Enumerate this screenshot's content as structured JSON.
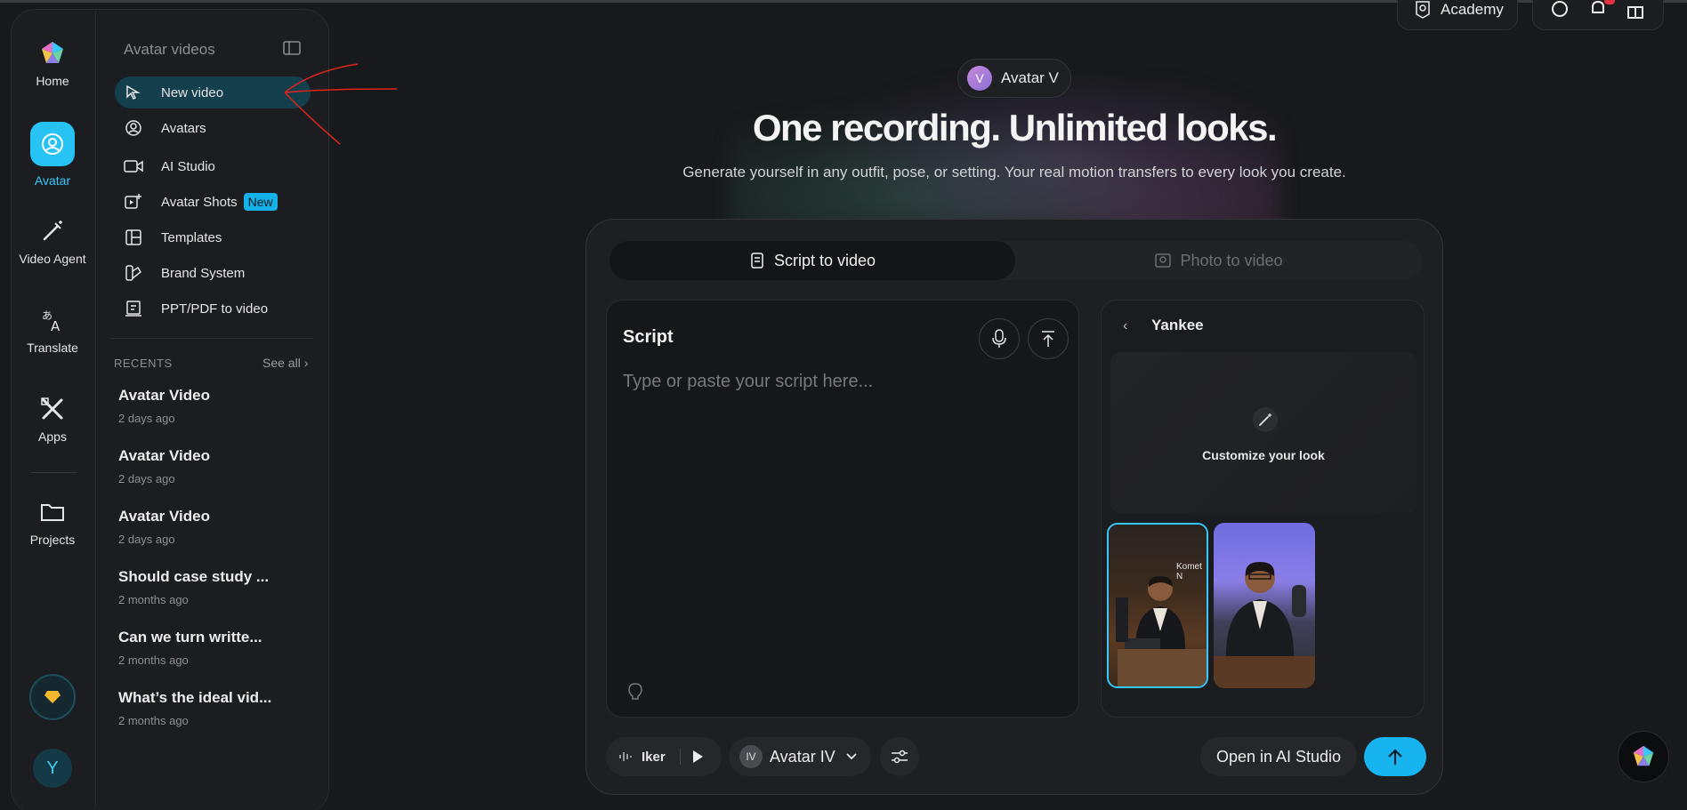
{
  "rail": {
    "home": "Home",
    "avatar": "Avatar",
    "video_agent": "Video Agent",
    "translate": "Translate",
    "apps": "Apps",
    "projects": "Projects",
    "user_initial": "Y"
  },
  "menu": {
    "title": "Avatar videos",
    "items": [
      {
        "label": "New video",
        "icon": "cursor-icon"
      },
      {
        "label": "Avatars",
        "icon": "avatar-circle-icon"
      },
      {
        "label": "AI Studio",
        "icon": "video-camera-icon"
      },
      {
        "label": "Avatar Shots",
        "icon": "image-plus-icon",
        "badge": "New"
      },
      {
        "label": "Templates",
        "icon": "layout-icon"
      },
      {
        "label": "Brand System",
        "icon": "brand-icon"
      },
      {
        "label": "PPT/PDF to video",
        "icon": "slides-icon"
      }
    ],
    "recents_label": "RECENTS",
    "see_all": "See all ›",
    "recents": [
      {
        "title": "Avatar Video",
        "time": "2 days ago"
      },
      {
        "title": "Avatar Video",
        "time": "2 days ago"
      },
      {
        "title": "Avatar Video",
        "time": "2 days ago"
      },
      {
        "title": "Should case study ...",
        "time": "2 months ago"
      },
      {
        "title": "Can we turn writte...",
        "time": "2 months ago"
      },
      {
        "title": "What’s the ideal vid...",
        "time": "2 months ago"
      }
    ]
  },
  "topbar": {
    "academy": "Academy"
  },
  "hero": {
    "chip_initial": "V",
    "chip_label": "Avatar V",
    "title": "One recording. Unlimited looks.",
    "subtitle": "Generate yourself in any outfit, pose, or setting. Your real motion transfers to every look you create."
  },
  "card": {
    "tab_script": "Script to video",
    "tab_photo": "Photo to video",
    "script_label": "Script",
    "script_placeholder": "Type or paste your script here...",
    "avatar_name": "Yankee",
    "customize_label": "Customize your look",
    "thumb_label": "Komet N",
    "voice_label": "Iker",
    "model_initials": "IV",
    "model_label": "Avatar IV",
    "open_ai_studio": "Open in AI Studio"
  },
  "colors": {
    "accent": "#27c3f5",
    "background": "#18191c",
    "active_menu": "#143f4c",
    "badge": "#14b2e9"
  }
}
